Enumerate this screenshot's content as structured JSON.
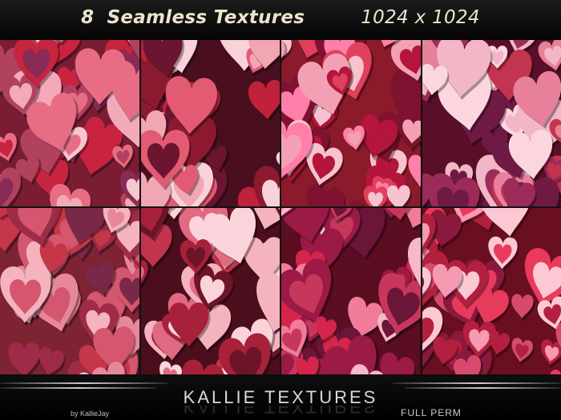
{
  "header": {
    "count": "8",
    "title": "Seamless Textures",
    "dimensions": "1024 x 1024"
  },
  "tiles": [
    {
      "bg": "#7a1d33",
      "colors": [
        "#f4a9b8",
        "#c9243f",
        "#e86d84",
        "#8a2a56",
        "#f7c7d0",
        "#b0415f"
      ]
    },
    {
      "bg": "#4a0f1f",
      "colors": [
        "#c0213b",
        "#f2a5b3",
        "#8c1a2e",
        "#e35a73",
        "#f9d1d8",
        "#6b1530"
      ]
    },
    {
      "bg": "#8b1a2a",
      "colors": [
        "#f7c3cf",
        "#e0405c",
        "#b3163a",
        "#ff7fa8",
        "#7e1230",
        "#f3a0b5"
      ]
    },
    {
      "bg": "#5a0f28",
      "colors": [
        "#9c2b5a",
        "#f2b6c6",
        "#c3344f",
        "#e7809a",
        "#6f1a45",
        "#fbd6de"
      ]
    },
    {
      "bg": "#7e2332",
      "colors": [
        "#e7889a",
        "#c63649",
        "#f4b3bf",
        "#9e2b47",
        "#d4566f",
        "#7a2848"
      ]
    },
    {
      "bg": "#4b0e1c",
      "colors": [
        "#f5b3c0",
        "#a7213a",
        "#6e1428",
        "#e06a82",
        "#fbd4db",
        "#c2344e"
      ]
    },
    {
      "bg": "#5b0d22",
      "colors": [
        "#d6244a",
        "#f07c9a",
        "#9b1a46",
        "#f7b9c8",
        "#6b1538",
        "#c7375c"
      ]
    },
    {
      "bg": "#6a0f20",
      "colors": [
        "#e83a5d",
        "#f59ab2",
        "#b3203f",
        "#8a1a3d",
        "#fbc8d4",
        "#d64b6b"
      ]
    }
  ],
  "footer": {
    "brand": "KALLIE TEXTURES",
    "byline": "by KallieJay",
    "permission": "FULL PERM"
  }
}
